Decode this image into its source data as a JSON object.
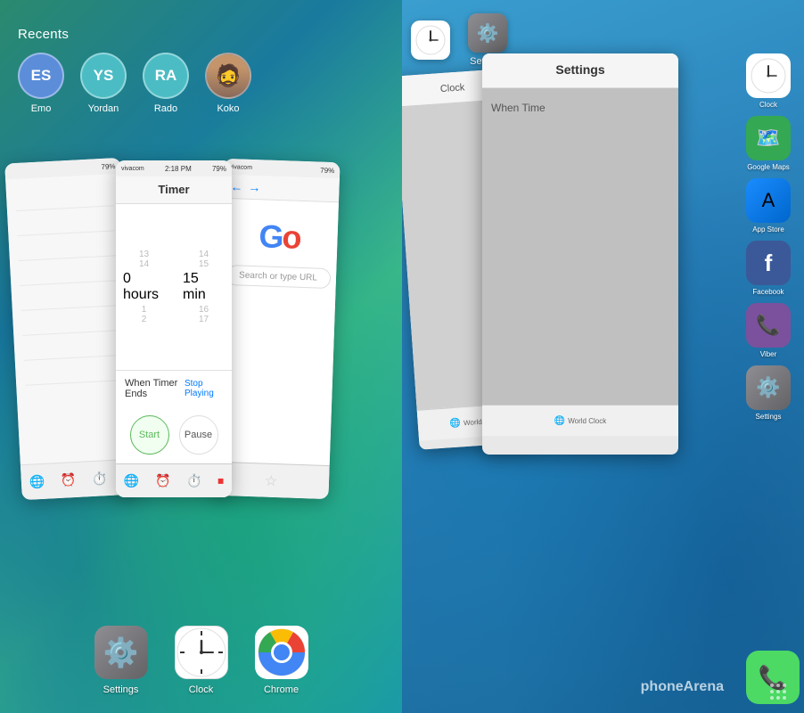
{
  "left_panel": {
    "recents_label": "Recents",
    "avatars": [
      {
        "initials": "ES",
        "name": "Emo",
        "color": "es"
      },
      {
        "initials": "YS",
        "name": "Yordan",
        "color": "ys"
      },
      {
        "initials": "RA",
        "name": "Rado",
        "color": "ra"
      },
      {
        "initials": "👤",
        "name": "Koko",
        "color": "photo"
      }
    ],
    "card1": {
      "statusbar": "79%"
    },
    "card2": {
      "statusbar_carrier": "vivacom",
      "statusbar_time": "2:18 PM",
      "statusbar_battery": "79%",
      "title": "Timer",
      "picker_hours_label": "0 hours",
      "picker_mins_label": "15 min",
      "picker_numbers": [
        "13",
        "14",
        "0",
        "1",
        "2",
        "15",
        "16",
        "17"
      ],
      "when_timer_ends": "When Timer Ends",
      "stop_playing": "Stop Playing",
      "btn_start": "Start",
      "btn_pause": "Pause"
    },
    "card3": {
      "statusbar_carrier": "vivacom",
      "statusbar_battery": "79%",
      "google_text": "Go",
      "search_placeholder": "Search or type URL"
    },
    "dock": [
      {
        "label": "Settings",
        "icon": "⚙️"
      },
      {
        "label": "Clock",
        "icon": "🕐"
      },
      {
        "label": "Chrome",
        "icon": "chrome"
      }
    ]
  },
  "right_panel": {
    "switcher_apps": [
      {
        "icon": "🕐",
        "label": "Clock"
      },
      {
        "icon": "⚙️",
        "label": "Settings"
      }
    ],
    "settings_card_title": "Settings",
    "when_timer_text": "When Time",
    "sidebar_apps": [
      {
        "label": "Clock",
        "bg": "#f0f0f0"
      },
      {
        "label": "Google Maps",
        "bg": "#4caf50"
      },
      {
        "label": "App Store",
        "bg": "#1a8cff"
      },
      {
        "label": "Facebook",
        "bg": "#3b5998"
      },
      {
        "label": "Viber",
        "bg": "#7b519d"
      },
      {
        "label": "Settings",
        "bg": "#8e8e93"
      }
    ],
    "watermark_phone": "phone",
    "watermark_arena": "Arena",
    "bottom_globe_label": "World Clock"
  }
}
